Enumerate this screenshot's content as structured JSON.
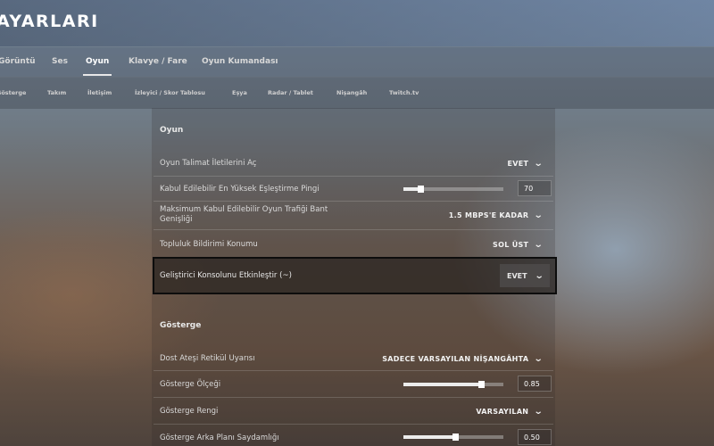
{
  "header": {
    "title": "AYARLARI"
  },
  "tabs": [
    {
      "label": "Görüntü"
    },
    {
      "label": "Ses"
    },
    {
      "label": "Oyun"
    },
    {
      "label": "Klavye / Fare"
    },
    {
      "label": "Oyun Kumandası"
    }
  ],
  "active_tab": "Oyun",
  "subtabs": [
    {
      "label": "Gösterge"
    },
    {
      "label": "Takım"
    },
    {
      "label": "İletişim"
    },
    {
      "label": "İzleyici / Skor Tablosu"
    },
    {
      "label": "Eşya"
    },
    {
      "label": "Radar / Tablet"
    },
    {
      "label": "Nişangâh"
    },
    {
      "label": "Twitch.tv"
    }
  ],
  "sections": {
    "oyun": {
      "title": "Oyun",
      "rows": {
        "instructor": {
          "label": "Oyun Talimat İletilerini Aç",
          "value": "EVET"
        },
        "max_ping": {
          "label": "Kabul Edilebilir En Yüksek Eşleştirme Pingi",
          "value": "70",
          "level": 0.17
        },
        "bandwidth": {
          "label": "Maksimum Kabul Edilebilir Oyun Trafiği Bant Genişliği",
          "value": "1.5 MBPS'E KADAR"
        },
        "notification": {
          "label": "Topluluk Bildirimi Konumu",
          "value": "SOL ÜST"
        },
        "console": {
          "label": "Geliştirici Konsolunu Etkinleştir (~)",
          "value": "EVET"
        }
      }
    },
    "gosterge": {
      "title": "Gösterge",
      "rows": {
        "friendly_fire": {
          "label": "Dost Ateşi Retikül Uyarısı",
          "value": "SADECE VARSAYILAN NİŞANGÂHTA"
        },
        "hud_scale": {
          "label": "Gösterge Ölçeği",
          "value": "0.85",
          "level": 0.78
        },
        "hud_color": {
          "label": "Gösterge Rengi",
          "value": "VARSAYILAN"
        },
        "hud_alpha": {
          "label": "Gösterge Arka Planı Saydamlığı",
          "value": "0.50",
          "level": 0.52
        }
      }
    }
  },
  "icons": {
    "dropdown": "chevron-down-icon"
  }
}
